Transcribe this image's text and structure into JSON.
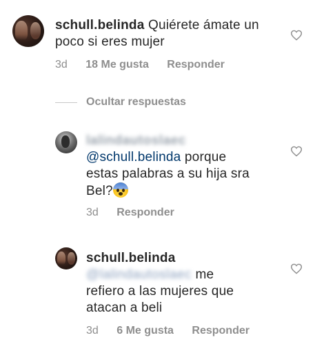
{
  "comments": [
    {
      "username": "schull.belinda",
      "text": "Quiérete ámate un poco si eres mujer",
      "time": "3d",
      "likes": "18 Me gusta",
      "reply_label": "Responder"
    },
    {
      "blurred_username": "lalindautoslaec",
      "mention": "@schull.belinda",
      "text_line1_rest": "porque",
      "text_line2": "estas palabras a su hija sra",
      "text_line3": "Bel?",
      "emoji": "😨",
      "time": "3d",
      "reply_label": "Responder"
    },
    {
      "username": "schull.belinda",
      "blurred_mention": "@lalindautoslaec",
      "text_line1_rest": "me",
      "text_line2": "refiero a las mujeres que",
      "text_line3": "atacan a beli",
      "time": "3d",
      "likes": "6 Me gusta",
      "reply_label": "Responder"
    }
  ],
  "hide_replies_label": "Ocultar respuestas",
  "icons": {
    "like": "heart-outline-icon",
    "avatar": "profile-photo"
  },
  "colors": {
    "text": "#262626",
    "meta": "#8e8e8e",
    "mention": "#00376b",
    "heart": "#8e8e8e"
  }
}
